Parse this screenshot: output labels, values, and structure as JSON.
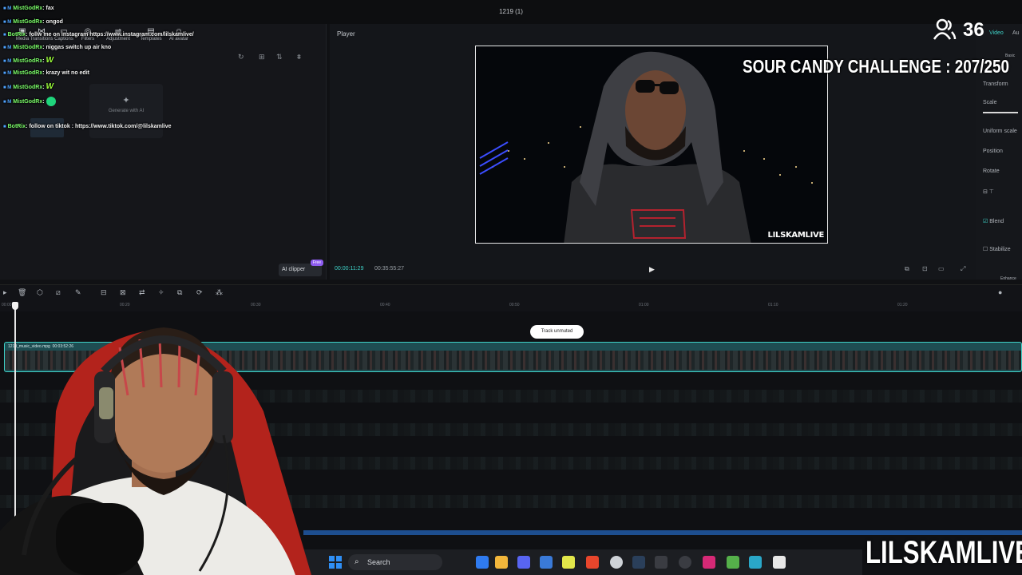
{
  "window": {
    "project_title": "1219 (1)"
  },
  "media_panel": {
    "tabs": [
      {
        "label": "Media",
        "icon": "media-icon"
      },
      {
        "label": "Transitions",
        "icon": "transition-icon"
      },
      {
        "label": "Captions",
        "icon": "caption-icon"
      },
      {
        "label": "Filters",
        "icon": "filter-icon"
      },
      {
        "label": "Adjustment",
        "icon": "adjustment-icon"
      },
      {
        "label": "Templates",
        "icon": "template-icon"
      },
      {
        "label": "AI avatar",
        "icon": "avatar-icon"
      }
    ],
    "generate_ai_label": "Generate with AI",
    "ai_clipper_label": "AI clipper",
    "ai_clipper_badge": "Free"
  },
  "chat": [
    {
      "user": "MistGodRx",
      "text": ": fax",
      "style": "mist"
    },
    {
      "user": "MistGodRx",
      "text": ": ongod",
      "style": "mist"
    },
    {
      "user": "BotRix",
      "text": ": follw me on instagram https://www.instagram.com/lilskamlive/",
      "style": "bot"
    },
    {
      "user": "MistGodRx",
      "text": ": niggas switch up air kno",
      "style": "mist"
    },
    {
      "user": "MistGodRx",
      "text": ":",
      "style": "mist",
      "emote": "W"
    },
    {
      "user": "MistGodRx",
      "text": ": krazy wit no edit",
      "style": "mist"
    },
    {
      "user": "MistGodRx",
      "text": ":",
      "style": "mist",
      "emote": "W"
    },
    {
      "user": "MistGodRx",
      "text": ":",
      "style": "mist",
      "emote": "face"
    },
    {
      "user": "BotRix",
      "text": ": follow on tiktok : https://www.tiktok.com/@lilskamlive",
      "style": "bot"
    }
  ],
  "player": {
    "label": "Player",
    "current_time": "00:00:11:29",
    "duration": "00:35:55:27",
    "watermark": "LILSKAMLIVE"
  },
  "properties": {
    "tabs": [
      "Video",
      "Au"
    ],
    "sub_tab": "Basic",
    "items": [
      "Transform",
      "Scale",
      "Uniform scale",
      "Position",
      "Rotate",
      "Blend",
      "Stabilize",
      "Enhance"
    ]
  },
  "overlay": {
    "viewer_count": "36",
    "challenge": "SOUR CANDY CHALLENGE : 207/250",
    "brand": "LILSKAMLIVE"
  },
  "timeline": {
    "ruler_ticks": [
      "00:00",
      "00:20",
      "00:30",
      "00:40",
      "00:50",
      "01:00",
      "01:10",
      "01:20"
    ],
    "toast": "Track unmuted",
    "clip_name": "1219_music_video.mpg",
    "clip_duration": "00:03:52:26"
  },
  "taskbar": {
    "search_label": "Search"
  },
  "colors": {
    "accent": "#3fd2c8",
    "chat_user": "#7cff6a",
    "windows_blue": "#2f8ff5"
  }
}
